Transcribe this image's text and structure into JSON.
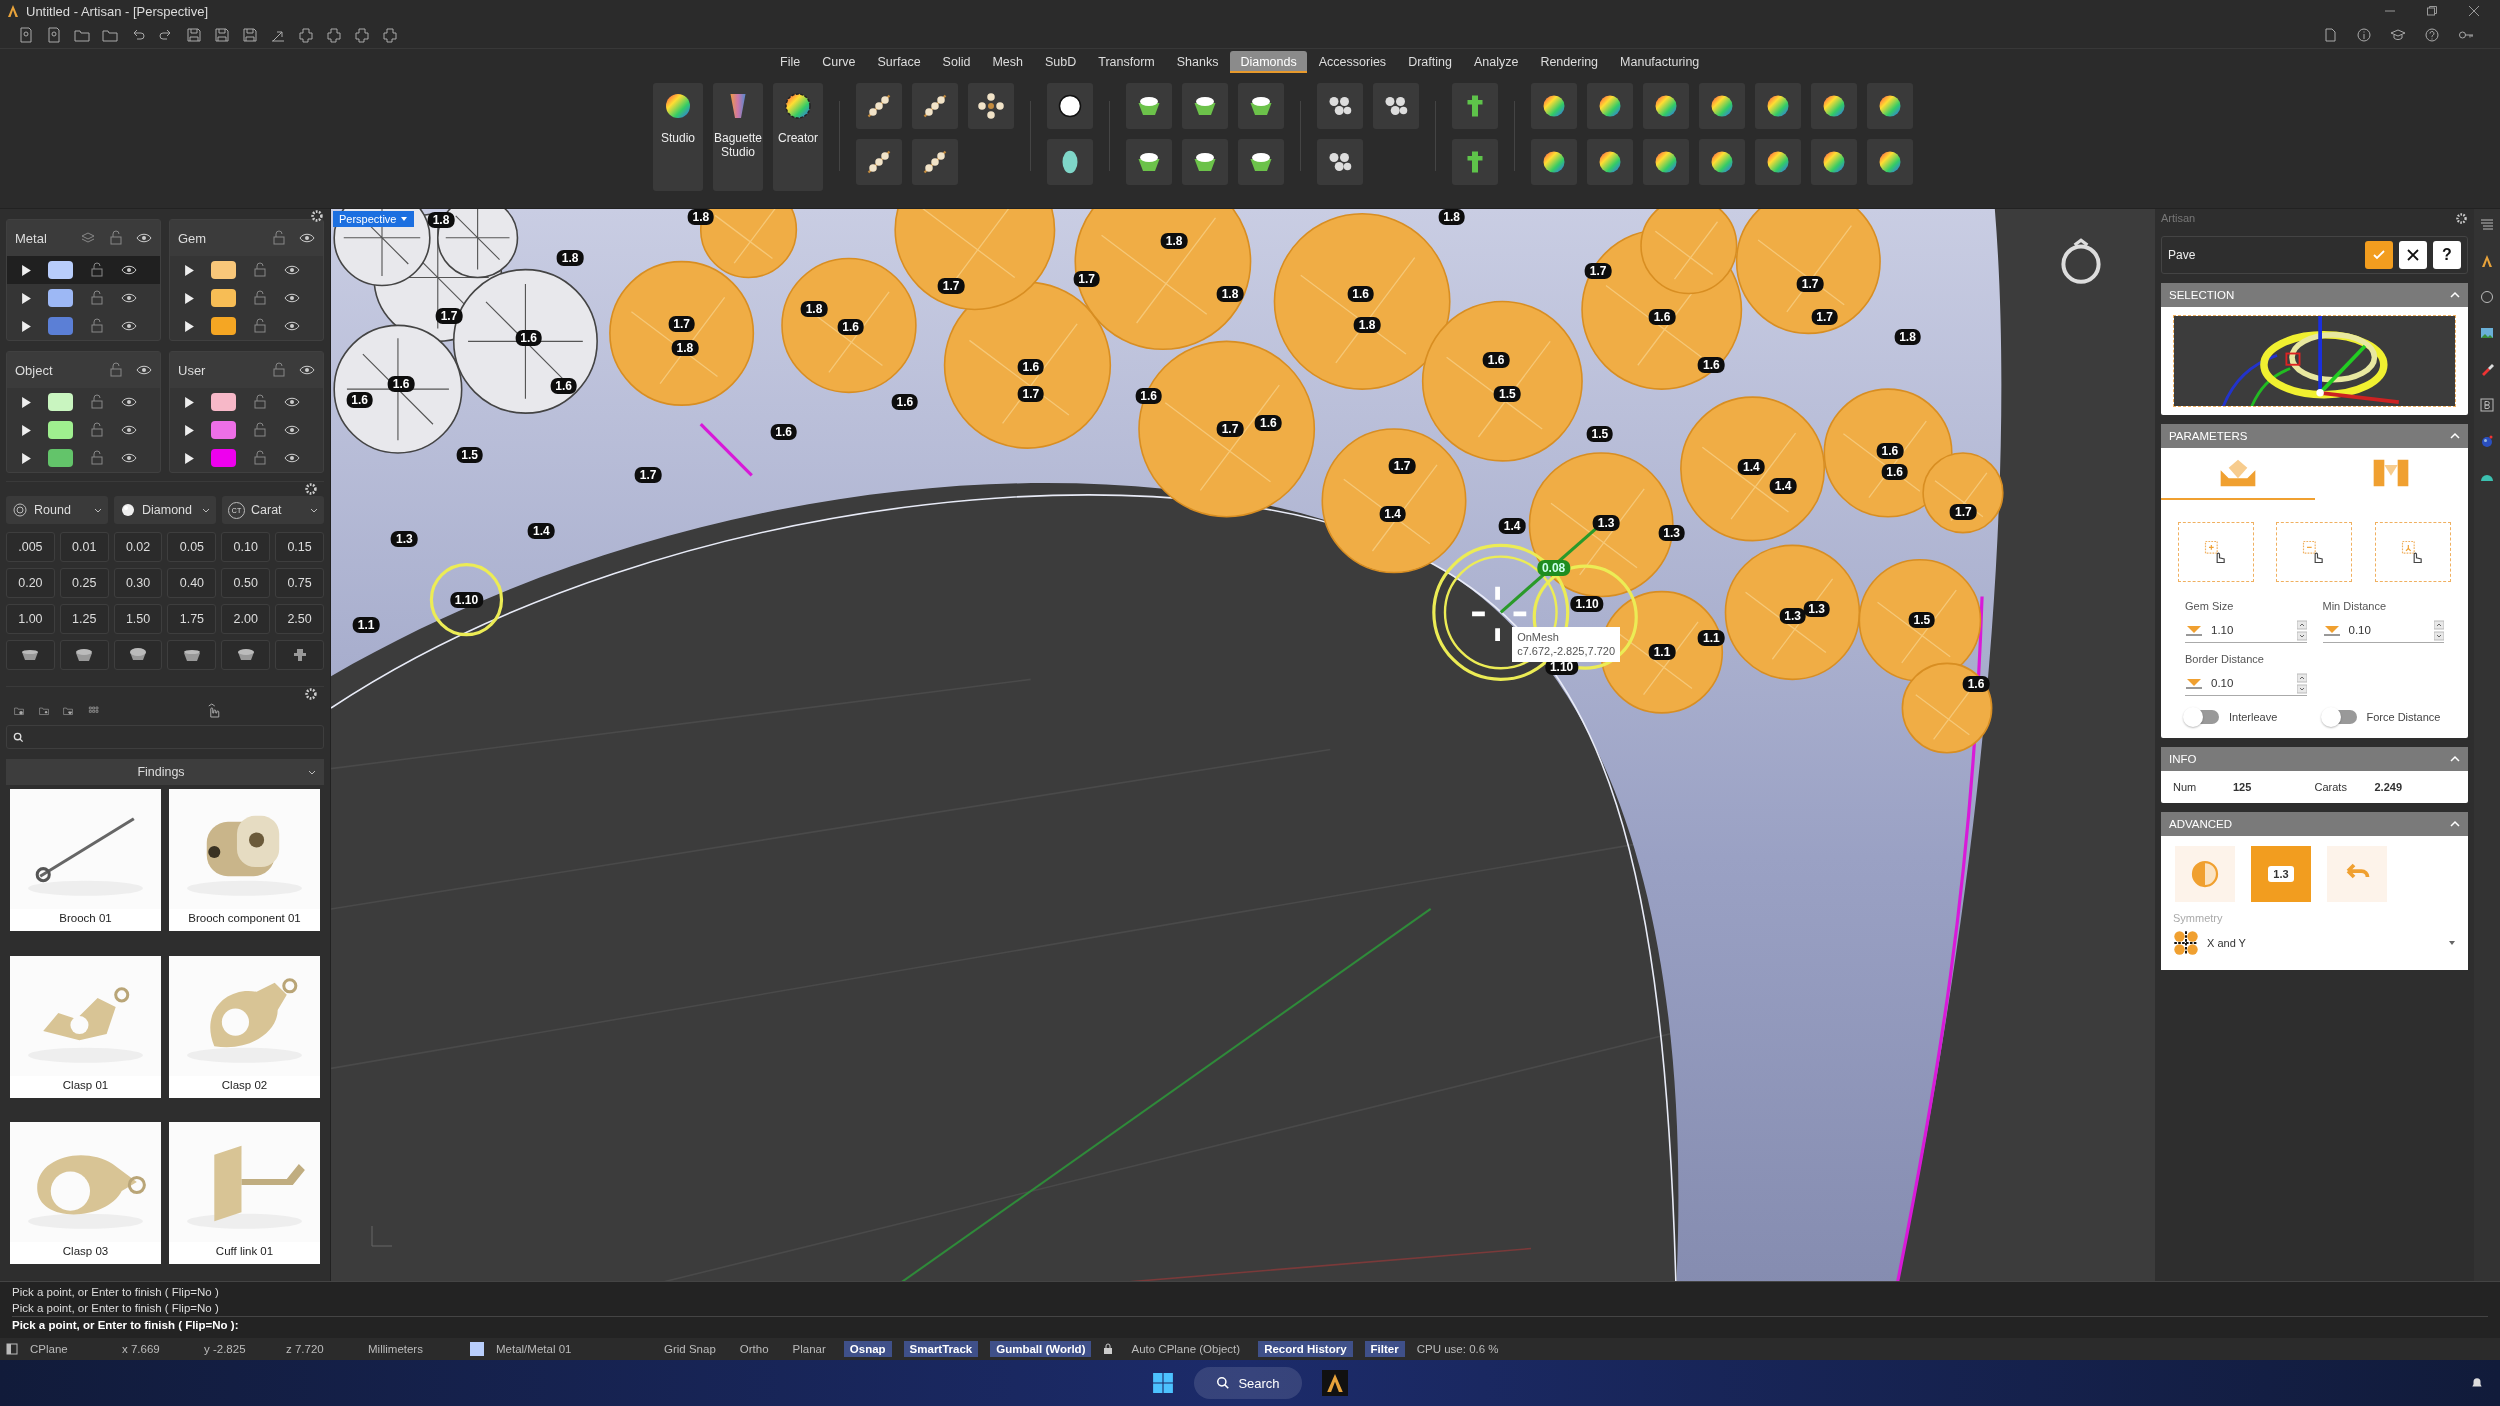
{
  "window": {
    "title": "Untitled - Artisan - [Perspective]"
  },
  "menu": [
    {
      "label": "File",
      "selected": false
    },
    {
      "label": "Curve",
      "selected": false
    },
    {
      "label": "Surface",
      "selected": false
    },
    {
      "label": "Solid",
      "selected": false
    },
    {
      "label": "Mesh",
      "selected": false
    },
    {
      "label": "SubD",
      "selected": false
    },
    {
      "label": "Transform",
      "selected": false
    },
    {
      "label": "Shanks",
      "selected": false
    },
    {
      "label": "Diamonds",
      "selected": true
    },
    {
      "label": "Accessories",
      "selected": false
    },
    {
      "label": "Drafting",
      "selected": false
    },
    {
      "label": "Analyze",
      "selected": false
    },
    {
      "label": "Rendering",
      "selected": false
    },
    {
      "label": "Manufacturing",
      "selected": false
    }
  ],
  "ribbon": {
    "big_buttons": [
      "Studio",
      "Baguette Studio",
      "Creator"
    ]
  },
  "layers": [
    {
      "title": "Metal",
      "rows": [
        {
          "color": "#b8cdfb",
          "selected": true
        },
        {
          "color": "#9db8f5",
          "selected": false
        },
        {
          "color": "#5b7fd6",
          "selected": false
        }
      ]
    },
    {
      "title": "Gem",
      "rows": [
        {
          "color": "#f9c77a",
          "selected": false
        },
        {
          "color": "#f7bd55",
          "selected": false
        },
        {
          "color": "#f5a623",
          "selected": false
        }
      ]
    },
    {
      "title": "Object",
      "rows": [
        {
          "color": "#c9f5c0",
          "selected": false
        },
        {
          "color": "#9fef8f",
          "selected": false
        },
        {
          "color": "#63c46a",
          "selected": false
        }
      ]
    },
    {
      "title": "User",
      "rows": [
        {
          "color": "#f7b8c8",
          "selected": false
        },
        {
          "color": "#ee6fe8",
          "selected": false
        },
        {
          "color": "#ee00ee",
          "selected": false
        }
      ]
    }
  ],
  "gem_setup": {
    "shape": "Round",
    "material": "Diamond",
    "unit": "Carat",
    "unit_icon": "CT",
    "sizes": [
      ".005",
      "0.01",
      "0.02",
      "0.05",
      "0.10",
      "0.15",
      "0.20",
      "0.25",
      "0.30",
      "0.40",
      "0.50",
      "0.75",
      "1.00",
      "1.25",
      "1.50",
      "1.75",
      "2.00",
      "2.50"
    ]
  },
  "library": {
    "category": "Findings",
    "items": [
      {
        "label": "Brooch 01"
      },
      {
        "label": "Brooch component 01"
      },
      {
        "label": "Clasp 01"
      },
      {
        "label": "Clasp 02"
      },
      {
        "label": "Clasp 03"
      },
      {
        "label": "Cuff link 01"
      }
    ]
  },
  "viewport": {
    "view": "Perspective",
    "distance_label": "0.08",
    "tooltip": {
      "snap": "OnMesh",
      "coords": "c7.672,-2.825,7.720"
    },
    "gem_labels": [
      "1.8",
      "1.8",
      "1.8",
      "1.8",
      "1.8",
      "1.7",
      "1.7",
      "1.7",
      "1.7",
      "1.8",
      "1.6",
      "1.7",
      "1.7",
      "1.8",
      "1.6",
      "1.8",
      "1.6",
      "1.7",
      "1.6",
      "1.8",
      "1.8",
      "1.6",
      "1.6",
      "1.6",
      "1.6",
      "1.6",
      "1.6",
      "1.6",
      "1.7",
      "1.6",
      "1.5",
      "1.6",
      "1.7",
      "1.6",
      "1.5",
      "1.5",
      "1.7",
      "1.7",
      "1.4",
      "1.4",
      "1.6",
      "1.6",
      "1.3",
      "1.4",
      "1.4",
      "1.4",
      "1.3",
      "1.3",
      "1.7",
      "1.1",
      "1.10",
      "1.10",
      "1.3",
      "1.3",
      "1.5",
      "1.1",
      "1.1",
      "1.10",
      "1.6"
    ]
  },
  "artisan": {
    "title": "Artisan",
    "command": "Pave",
    "help": "?",
    "selection_title": "SELECTION",
    "parameters_title": "PARAMETERS",
    "tabs": [
      {
        "selected": true
      },
      {
        "selected": false
      }
    ],
    "fields": [
      {
        "label": "Gem Size",
        "value": "1.10"
      },
      {
        "label": "Min Distance",
        "value": "0.10"
      },
      {
        "label": "Border Distance",
        "value": "0.10"
      }
    ],
    "toggles": [
      {
        "label": "Interleave",
        "on": false
      },
      {
        "label": "Force Distance",
        "on": false
      }
    ],
    "info_title": "INFO",
    "info": [
      {
        "label": "Num",
        "value": "125"
      },
      {
        "label": "Carats",
        "value": "2.249"
      }
    ],
    "advanced_title": "ADVANCED",
    "advanced_buttons": [
      {
        "kind": "gem",
        "selected": false
      },
      {
        "kind": "badge",
        "label": "1.3",
        "selected": true
      },
      {
        "kind": "undo",
        "selected": false
      }
    ],
    "symmetry_label": "Symmetry",
    "symmetry_value": "X and Y"
  },
  "command_history": [
    "Pick a point, or Enter to finish ( Flip=No )",
    "Pick a point, or Enter to finish ( Flip=No )"
  ],
  "command_prompt": "Pick a point, or Enter to finish ( Flip=No ):",
  "status_bar": {
    "cplane": "CPlane",
    "x": "x 7.669",
    "y": "y -2.825",
    "z": "z 7.720",
    "units": "Millimeters",
    "layer": "Metal/Metal 01",
    "toggles": [
      {
        "label": "Grid Snap",
        "on": false
      },
      {
        "label": "Ortho",
        "on": false
      },
      {
        "label": "Planar",
        "on": false
      },
      {
        "label": "Osnap",
        "on": true
      },
      {
        "label": "SmartTrack",
        "on": true
      },
      {
        "label": "Gumball (World)",
        "on": true
      },
      {
        "label": "Auto CPlane (Object)",
        "on": false,
        "kind": "lock"
      },
      {
        "label": "Record History",
        "on": true
      },
      {
        "label": "Filter",
        "on": true
      }
    ],
    "cpu": "CPU use: 0.6 %"
  },
  "taskbar": {
    "search": "Search"
  }
}
